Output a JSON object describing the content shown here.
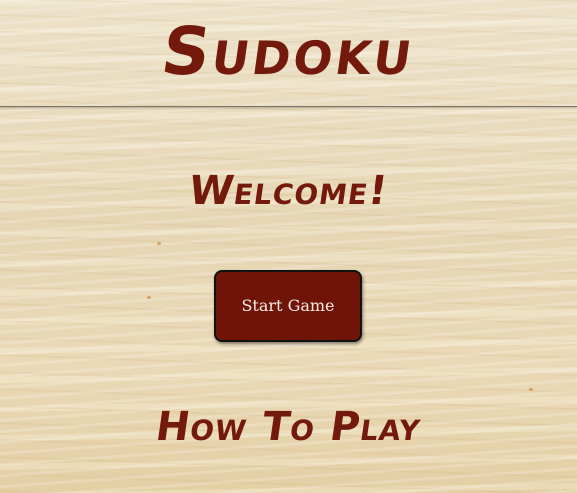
{
  "header": {
    "title": "Sudoku"
  },
  "main": {
    "welcome": "Welcome!",
    "start_button_label": "Start Game",
    "how_to_play_heading": "How To Play"
  },
  "colors": {
    "accent": "#741a0c",
    "button_background": "#711408",
    "button_text": "#f6ece4",
    "background": "#e9dcc0"
  }
}
